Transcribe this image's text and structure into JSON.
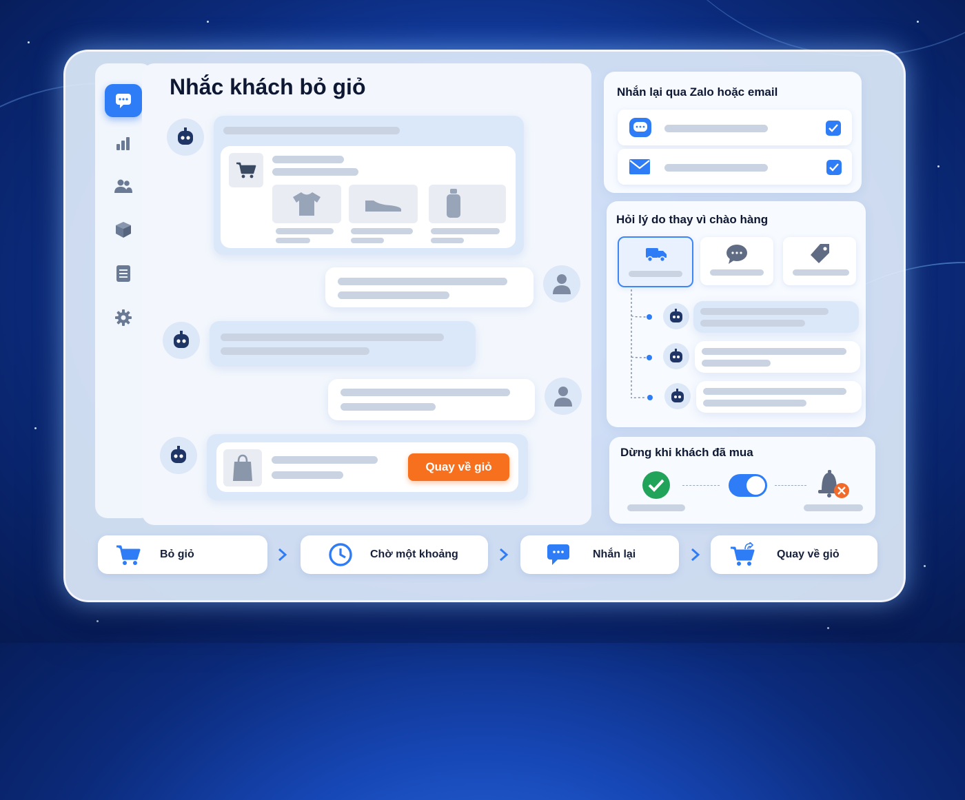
{
  "main": {
    "title": "Nhắc khách bỏ giỏ",
    "cta_label": "Quay về giỏ"
  },
  "panels": {
    "channels": {
      "title": "Nhắn lại qua Zalo hoặc email",
      "zalo_checked": true,
      "email_checked": true
    },
    "reasons": {
      "title": "Hỏi lý do thay vì chào hàng"
    },
    "stop": {
      "title": "Dừng khi khách đã mua",
      "toggle_on": true
    }
  },
  "flow": {
    "steps": [
      {
        "label": "Bỏ giỏ",
        "icon": "cart-icon"
      },
      {
        "label": "Chờ một khoảng",
        "icon": "clock-icon"
      },
      {
        "label": "Nhắn lại",
        "icon": "message-icon"
      },
      {
        "label": "Quay về giỏ",
        "icon": "cart-return-icon"
      }
    ]
  },
  "sidebar": {
    "icons": [
      "chat-icon",
      "chart-icon",
      "users-icon",
      "box-icon",
      "document-icon",
      "gear-icon"
    ]
  },
  "colors": {
    "accent": "#2e7cf6",
    "cta": "#f7701e",
    "success": "#22a35a",
    "danger": "#f26a2a"
  }
}
